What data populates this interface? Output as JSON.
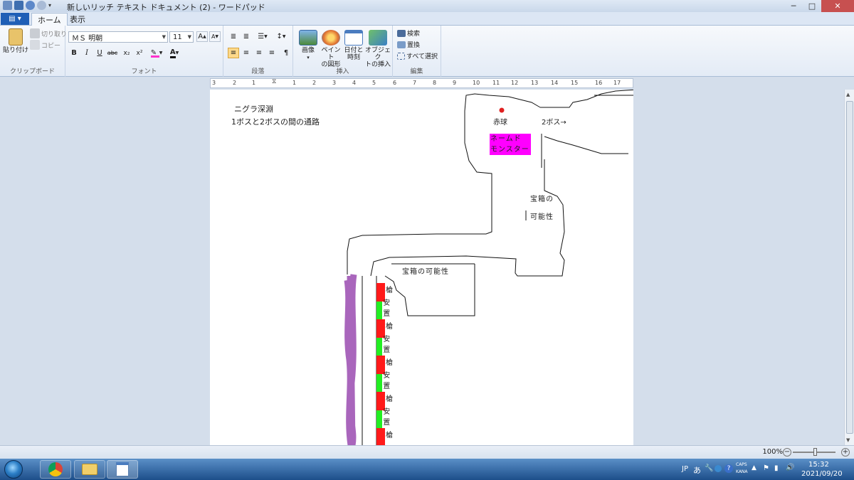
{
  "window": {
    "title": "新しいリッチ テキスト ドキュメント (2) - ワードパッド",
    "minimize": "─",
    "maximize": "□",
    "close": "✕"
  },
  "ribbon": {
    "tabs": [
      "ホーム",
      "表示"
    ],
    "clipboard": {
      "paste": "貼り付け",
      "cut": "切り取り",
      "copy": "コピー",
      "group": "クリップボード"
    },
    "font": {
      "family": "ＭＳ 明朝",
      "size": "11",
      "bold": "B",
      "italic": "I",
      "underline": "U",
      "strike": "abc",
      "subscript": "x₂",
      "superscript": "x²",
      "color_letter": "A",
      "group": "フォント"
    },
    "paragraph": {
      "group": "段落"
    },
    "insert": {
      "image": "画像",
      "paint_line1": "ペイント",
      "paint_line2": "の図形",
      "datetime_line1": "日付と",
      "datetime_line2": "時刻",
      "object_line1": "オブジェク",
      "object_line2": "トの挿入",
      "group": "挿入"
    },
    "edit": {
      "find": "検索",
      "replace": "置換",
      "select_all": "すべて選択",
      "group": "編集"
    }
  },
  "ruler": {
    "numbers": [
      "3",
      "2",
      "1",
      "1",
      "2",
      "3",
      "4",
      "5",
      "6",
      "7",
      "8",
      "9",
      "10",
      "11",
      "12",
      "13",
      "14",
      "15",
      "16",
      "17"
    ]
  },
  "document": {
    "line1": "ニグラ深淵",
    "line2": "1ボスと2ボスの間の通路",
    "red_orb": "赤球",
    "boss2": "2ボス→",
    "named_monster_1": "ネームド",
    "named_monster_2": "モンスター",
    "chest_a_1": "宝箱の",
    "chest_a_2": "可能性",
    "chest_b": "宝箱の可能性",
    "strip_labels": [
      "槍",
      "安置",
      "槍",
      "安置",
      "槍",
      "安置",
      "槍",
      "安置",
      "槍"
    ],
    "colors": {
      "spear": "#ff1a1a",
      "safe": "#22ee22",
      "named": "#ff00ff",
      "orb": "#e02020",
      "purple": "#9a4bb0"
    }
  },
  "statusbar": {
    "zoom": "100%",
    "zoom_out": "−",
    "zoom_in": "+"
  },
  "taskbar": {
    "lang": "JP",
    "ime": "あ",
    "caps": "CAPS",
    "kana": "KANA",
    "time": "15:32",
    "date": "2021/09/20"
  }
}
